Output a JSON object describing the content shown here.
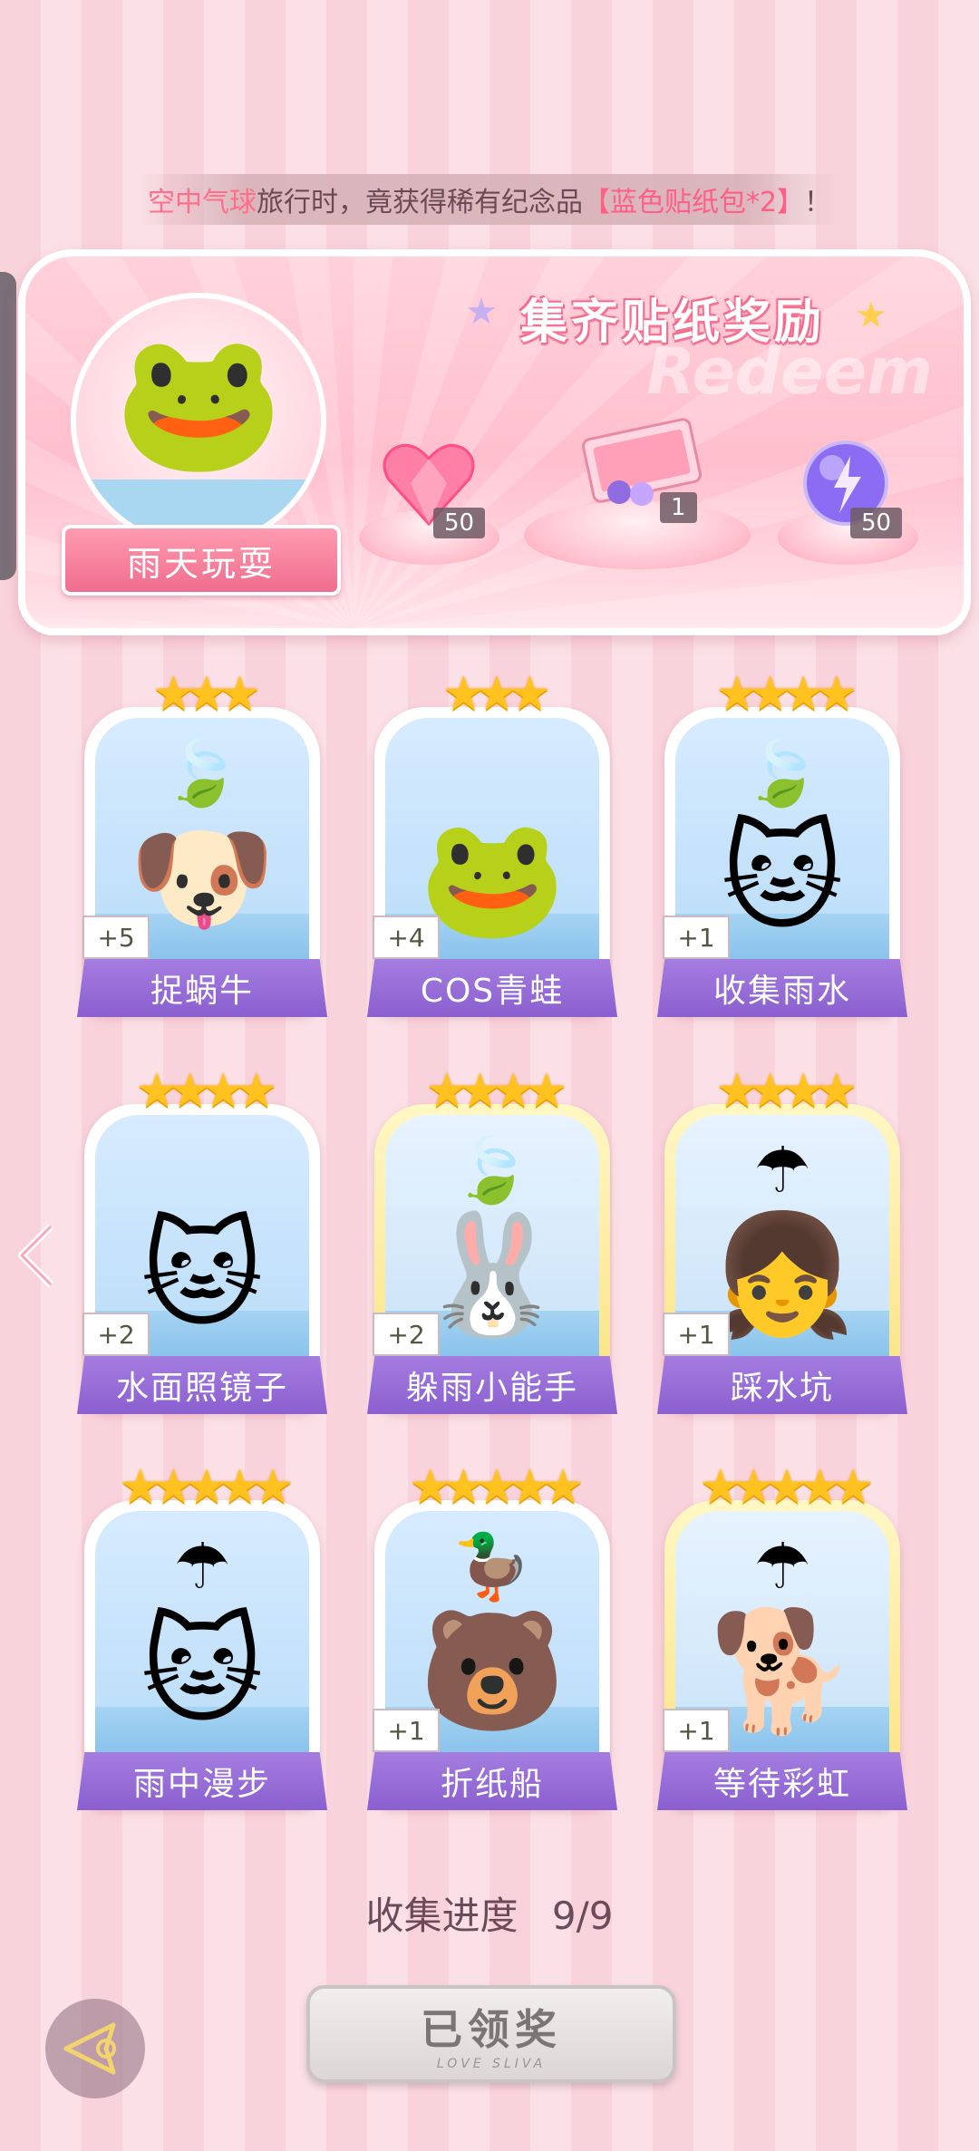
{
  "notice": {
    "prefix": "空中气球",
    "middle": "旅行时，竟获得稀有纪念品",
    "item": "【蓝色贴纸包*2】",
    "suffix": "！"
  },
  "reward_panel": {
    "title": "集齐贴纸奖励",
    "watermark": "Redeem",
    "theme_name": "雨天玩耍",
    "rewards": [
      {
        "name": "heart-gem",
        "count": "50"
      },
      {
        "name": "gift-box",
        "count": "1"
      },
      {
        "name": "purple-orb",
        "count": "50"
      }
    ]
  },
  "cards": [
    {
      "title": "捉蜗牛",
      "plus": "+5",
      "stars": "★★★",
      "gold": false,
      "figure": "🐶",
      "item": "🍃"
    },
    {
      "title": "COS青蛙",
      "plus": "+4",
      "stars": "★★★",
      "gold": false,
      "figure": "🐸",
      "item": ""
    },
    {
      "title": "收集雨水",
      "plus": "+1",
      "stars": "★★★★",
      "gold": false,
      "figure": "🐱",
      "item": "🍃"
    },
    {
      "title": "水面照镜子",
      "plus": "+2",
      "stars": "★★★★",
      "gold": false,
      "figure": "🐱",
      "item": ""
    },
    {
      "title": "躲雨小能手",
      "plus": "+2",
      "stars": "★★★★",
      "gold": true,
      "figure": "🐰",
      "item": "🍃"
    },
    {
      "title": "踩水坑",
      "plus": "+1",
      "stars": "★★★★",
      "gold": true,
      "figure": "👧",
      "item": "☂"
    },
    {
      "title": "雨中漫步",
      "plus": "",
      "stars": "★★★★★",
      "gold": false,
      "figure": "🐱",
      "item": "☂"
    },
    {
      "title": "折纸船",
      "plus": "+1",
      "stars": "★★★★★",
      "gold": false,
      "figure": "🐻",
      "item": "🦆"
    },
    {
      "title": "等待彩虹",
      "plus": "+1",
      "stars": "★★★★★",
      "gold": true,
      "figure": "🐕",
      "item": "☂"
    }
  ],
  "progress": {
    "label": "收集进度",
    "value": "9/9"
  },
  "claim_button": {
    "label": "已领奖",
    "sub": "LOVE SLIVA"
  },
  "colors": {
    "accent_pink": "#ff6f8a",
    "label_purple": "#8a5fcf",
    "star_gold": "#ffc21e"
  }
}
